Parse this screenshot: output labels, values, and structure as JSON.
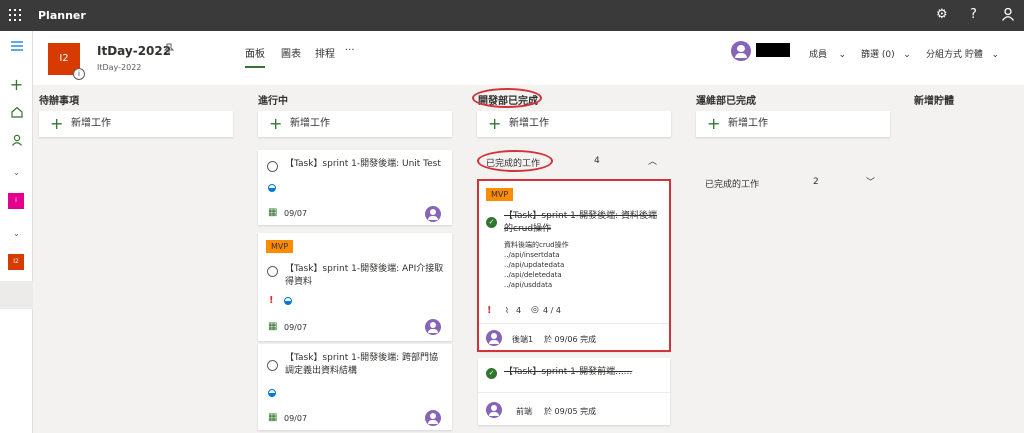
{
  "app": {
    "name": "Planner"
  },
  "plan": {
    "initials": "I2",
    "title": "ItDay-2022",
    "subtitle": "ItDay-2022",
    "info": "i"
  },
  "tabs": [
    {
      "label": "面板"
    },
    {
      "label": "圖表"
    },
    {
      "label": "排程"
    },
    {
      "label": "···"
    }
  ],
  "header_menu": {
    "members": "成員",
    "filter": "篩選 (0)",
    "group": "分組方式 貯體"
  },
  "rail": {
    "sq1": "I",
    "sq2": "I2"
  },
  "add_task_label": "新增工作",
  "columns": [
    {
      "title": "待辦事項"
    },
    {
      "title": "進行中"
    },
    {
      "title": "開發部已完成",
      "completed_label": "已完成的工作",
      "completed_count": "4"
    },
    {
      "title": "運維部已完成",
      "completed_label": "已完成的工作",
      "completed_count": "2"
    },
    {
      "title": "新增貯體"
    }
  ],
  "cards": {
    "unit_test": {
      "title": "【Task】sprint 1-開發後端: Unit Test",
      "due": "09/07"
    },
    "api_intro": {
      "label": "MVP",
      "title_l1": "【Task】sprint 1-開發後端: API介接取",
      "title_l2": "得資料",
      "urgent": "!",
      "due": "09/07"
    },
    "cross_dept": {
      "title_l1": "【Task】sprint 1-開發後端: 跨部門協",
      "title_l2": "調定義出資料結構",
      "due": "09/07"
    },
    "crud": {
      "label": "MVP",
      "title_l1": "【Task】sprint 1-開發後端: 資料後端",
      "title_l2": "的crud操作",
      "desc": [
        "資料後端的crud操作",
        "../api/insertdata",
        "../api/updatedata",
        "../api/deletedata",
        "../api/usddata"
      ],
      "urgent": "!",
      "attachments": "4",
      "checklist": "4 / 4",
      "completed_by": "後端1",
      "completed_on": "於 09/06 完成"
    },
    "frontend": {
      "title": "【Task】sprint 1-開發前端......",
      "completed_by": "前端",
      "completed_on": "於 09/05 完成"
    }
  },
  "colors": {
    "topbar": "#3a3a3a",
    "accent_green": "#31752f",
    "mvp_orange": "#ff8c00",
    "highlight_red": "#d13438",
    "avatar_purple": "#8764b8"
  }
}
